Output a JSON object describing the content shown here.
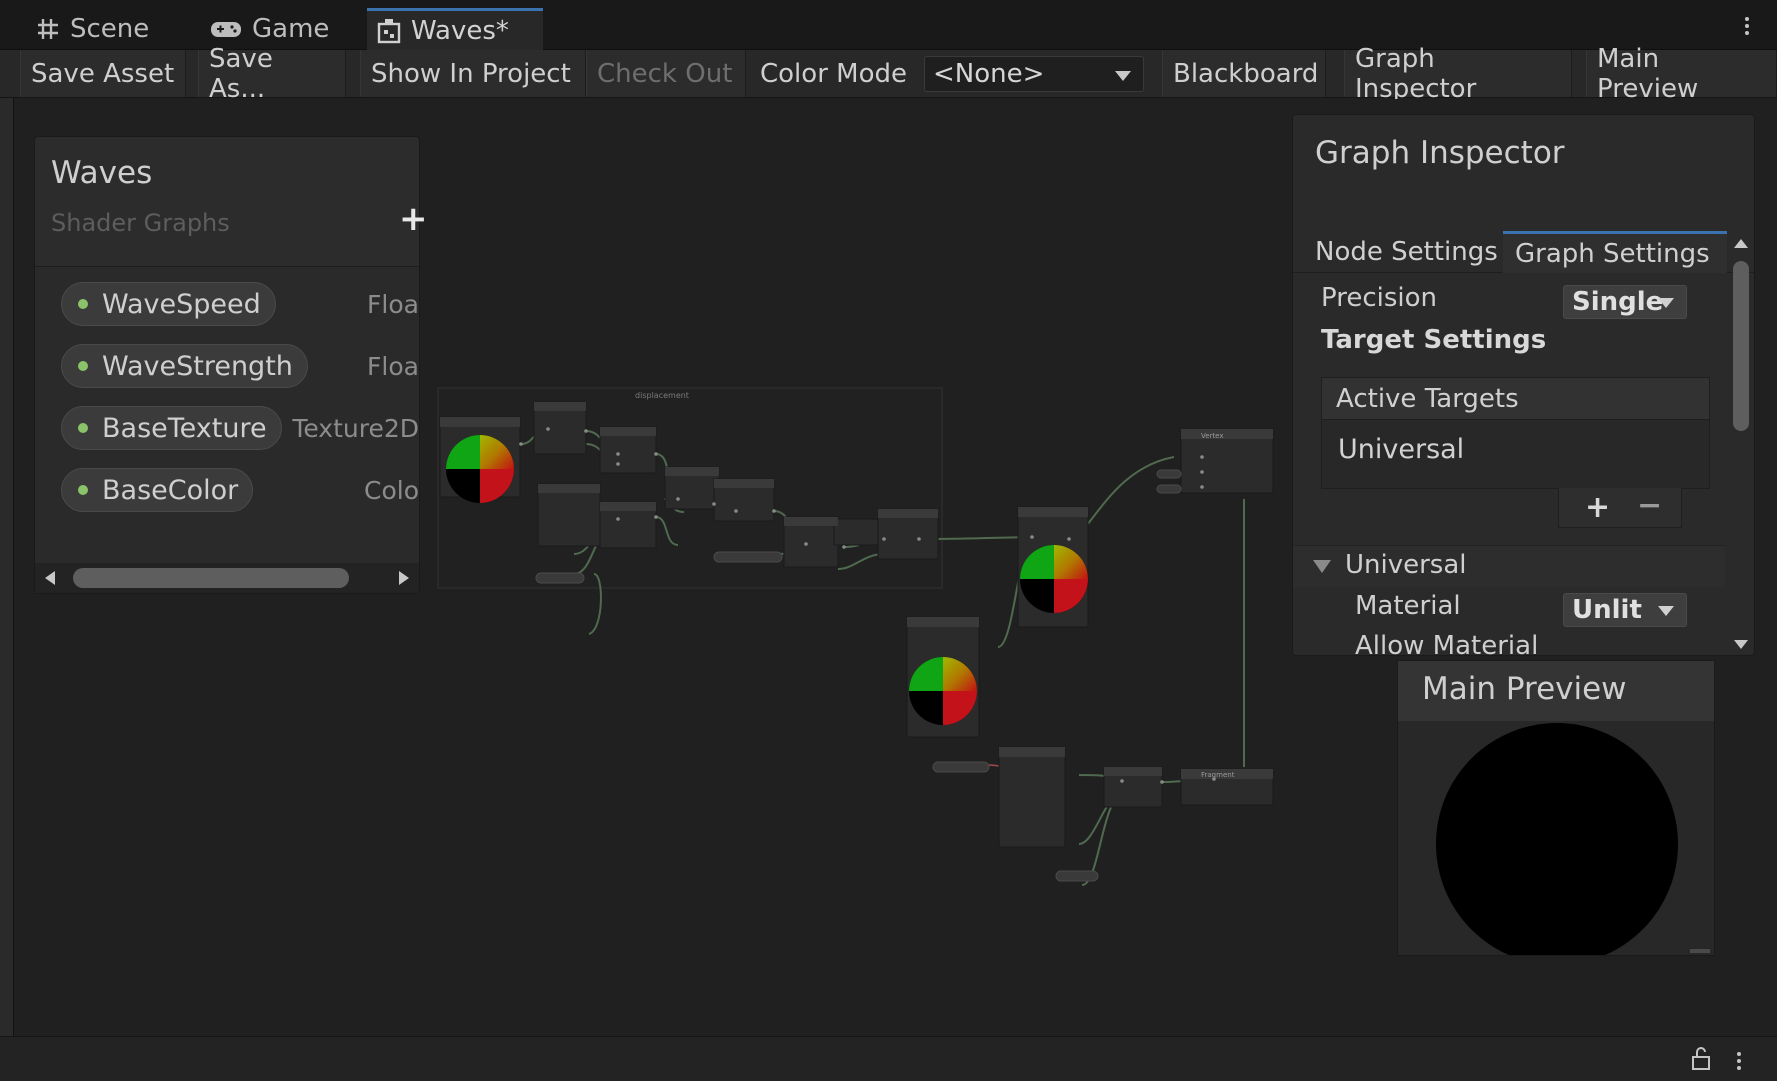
{
  "tabs": [
    {
      "label": "Scene",
      "icon": "grid-icon"
    },
    {
      "label": "Game",
      "icon": "gamepad-icon"
    },
    {
      "label": "Waves*",
      "icon": "shader-graph-icon",
      "active": true
    }
  ],
  "toolbar": {
    "save_asset": "Save Asset",
    "save_as": "Save As...",
    "show_in_project": "Show In Project",
    "check_out": "Check Out",
    "color_mode_label": "Color Mode",
    "color_mode_value": "<None>",
    "blackboard": "Blackboard",
    "graph_inspector": "Graph Inspector",
    "main_preview": "Main Preview"
  },
  "blackboard": {
    "title": "Waves",
    "subtitle": "Shader Graphs",
    "add_label": "+",
    "properties": [
      {
        "name": "WaveSpeed",
        "type": "Floa"
      },
      {
        "name": "WaveStrength",
        "type": "Floa"
      },
      {
        "name": "BaseTexture",
        "type": "Texture2D"
      },
      {
        "name": "BaseColor",
        "type": "Colo"
      }
    ]
  },
  "graph": {
    "group_label": "displacement",
    "vertex_label": "Vertex",
    "fragment_label": "Fragment"
  },
  "inspector": {
    "title": "Graph Inspector",
    "tabs": [
      "Node Settings",
      "Graph Settings"
    ],
    "active_tab": "Graph Settings",
    "precision_label": "Precision",
    "precision_value": "Single",
    "target_settings": "Target Settings",
    "active_targets": "Active Targets",
    "target_item": "Universal",
    "add": "+",
    "remove": "−",
    "section": "Universal",
    "material_label": "Material",
    "material_value": "Unlit",
    "allow_material": "Allow Material"
  },
  "preview": {
    "title": "Main Preview"
  },
  "colors": {
    "accent": "#3a72b0",
    "property_dot": "#8ac46a",
    "wire": "#5d7a55"
  }
}
